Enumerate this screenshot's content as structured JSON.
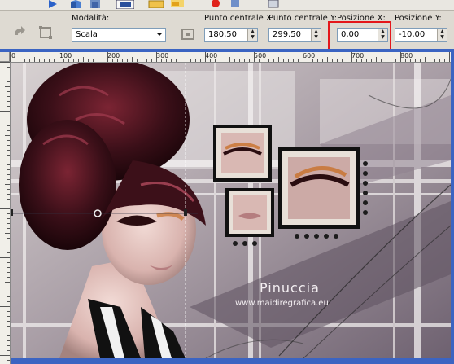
{
  "toolbar": {
    "icons": [
      "arrow-icon",
      "cube-icon",
      "layers-icon",
      "grid-icon",
      "folder-icon",
      "flag-icon",
      "record-icon",
      "paint-icon",
      "stamp-icon"
    ]
  },
  "props": {
    "mode_label": "Modalità:",
    "mode_value": "Scala",
    "center_x_label": "Punto centrale X:",
    "center_x_value": "180,50",
    "center_y_label": "Punto centrale Y:",
    "center_y_value": "299,50",
    "pos_x_label": "Posizione X:",
    "pos_x_value": "0,00",
    "pos_y_label": "Posizione Y:",
    "pos_y_value": "-10,00"
  },
  "ruler": {
    "h_labels": [
      "0",
      "100",
      "200",
      "300",
      "400",
      "500",
      "600",
      "700",
      "800"
    ]
  },
  "canvas": {
    "watermark_name": "Pinuccia",
    "watermark_url": "www.maidiregrafica.eu"
  },
  "colors": {
    "highlight": "#e4171b",
    "frame": "#3b64c2"
  }
}
